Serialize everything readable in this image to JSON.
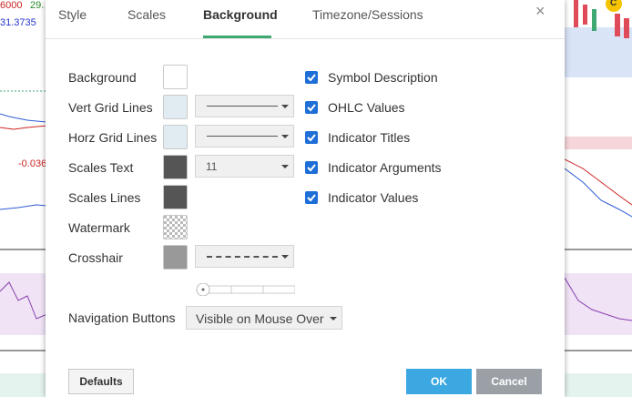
{
  "background_chart": {
    "left_texts": [
      "6000",
      "29.",
      "31.3735",
      "-0.036"
    ],
    "right_badge": "C"
  },
  "dialog": {
    "tabs": [
      "Style",
      "Scales",
      "Background",
      "Timezone/Sessions"
    ],
    "active_tab": "Background",
    "close_icon": "×",
    "rows": {
      "background": "Background",
      "vert_grid": "Vert Grid Lines",
      "horz_grid": "Horz Grid Lines",
      "scales_text": "Scales Text",
      "scales_lines": "Scales Lines",
      "watermark": "Watermark",
      "crosshair": "Crosshair"
    },
    "scales_text_size": "11",
    "checkboxes": [
      {
        "label": "Symbol Description",
        "checked": true
      },
      {
        "label": "OHLC Values",
        "checked": true
      },
      {
        "label": "Indicator Titles",
        "checked": true
      },
      {
        "label": "Indicator Arguments",
        "checked": true
      },
      {
        "label": "Indicator Values",
        "checked": true
      }
    ],
    "navigation_label": "Navigation Buttons",
    "navigation_value": "Visible on Mouse Over",
    "buttons": {
      "defaults": "Defaults",
      "ok": "OK",
      "cancel": "Cancel"
    },
    "colors": {
      "background_swatch": "#ffffff",
      "vert_grid_swatch": "#e1ecf2",
      "horz_grid_swatch": "#e1ecf2",
      "scales_text_swatch": "#555555",
      "scales_lines_swatch": "#555555",
      "crosshair_swatch": "#999999",
      "accent": "#3fa873",
      "checkbox": "#1e6ed8"
    }
  }
}
